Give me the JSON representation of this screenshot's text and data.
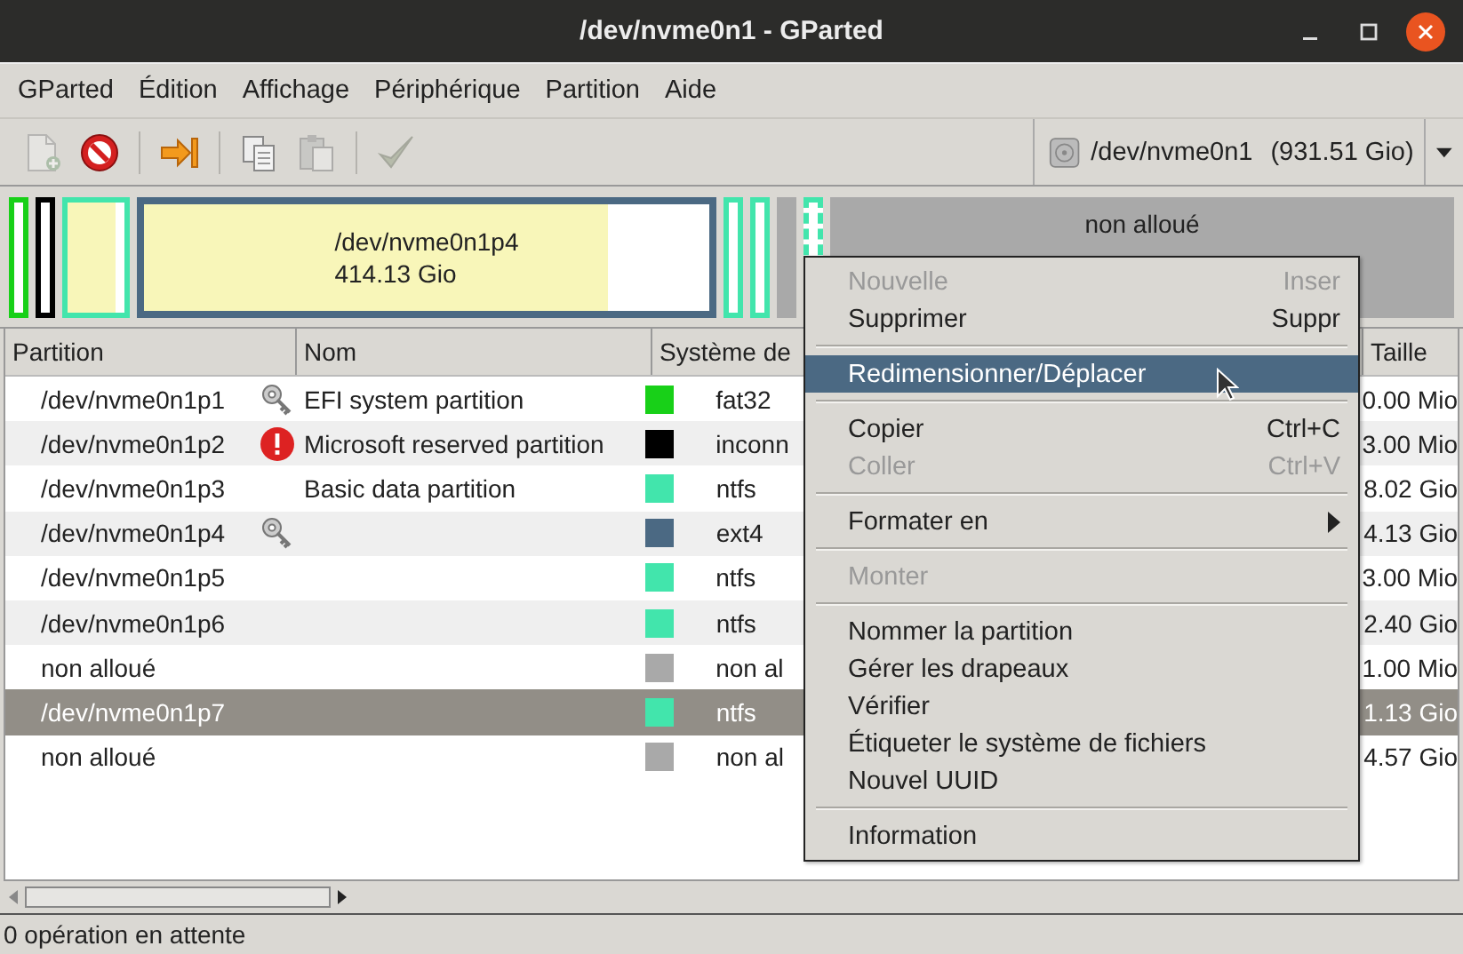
{
  "window": {
    "title": "/dev/nvme0n1 - GParted"
  },
  "menubar": [
    "GParted",
    "Édition",
    "Affichage",
    "Périphérique",
    "Partition",
    "Aide"
  ],
  "toolbar": [
    {
      "kind": "new",
      "disabled": true
    },
    {
      "kind": "delete",
      "disabled": false
    },
    {
      "kind": "sep"
    },
    {
      "kind": "resize",
      "disabled": false
    },
    {
      "kind": "sep"
    },
    {
      "kind": "copy",
      "disabled": false
    },
    {
      "kind": "paste",
      "disabled": true
    },
    {
      "kind": "sep"
    },
    {
      "kind": "apply",
      "disabled": true
    }
  ],
  "device": {
    "path": "/dev/nvme0n1",
    "size": "(931.51 Gio)"
  },
  "disk_map": [
    {
      "color": "#18d018",
      "selected": false
    },
    {
      "color": "#000000",
      "selected": false
    },
    {
      "color": "#42e5ac",
      "selected": false,
      "kind": "medium"
    },
    {
      "color": "#4b6983",
      "level": 0.82,
      "selected": false,
      "name": "/dev/nvme0n1p4",
      "size": "414.13 Gio",
      "kind": "wide"
    },
    {
      "color": "#42e5ac",
      "selected": false
    },
    {
      "color": "#42e5ac",
      "selected": false
    },
    {
      "color": "#a9a9a9",
      "kind": "unallocated",
      "selected": false
    },
    {
      "color": "#42e5ac",
      "selected": true
    },
    {
      "color": "#a9a9a9",
      "kind": "unallocated_wide",
      "selected": false,
      "name": "non alloué"
    }
  ],
  "table": {
    "columns": [
      "Partition",
      "Nom",
      "Système de ",
      "Taille"
    ],
    "rows": [
      {
        "partition": "/dev/nvme0n1p1",
        "kind": "key",
        "name": "EFI system partition",
        "color": "#18d018",
        "fs": "fat32",
        "size": "0.00 Mio",
        "selected": false
      },
      {
        "partition": "/dev/nvme0n1p2",
        "kind": "warning",
        "name": "Microsoft reserved partition",
        "color": "#000000",
        "fs": "inconn",
        "size": "3.00 Mio",
        "selected": false
      },
      {
        "partition": "/dev/nvme0n1p3",
        "kind": "plain",
        "name": "Basic data partition",
        "color": "#42e5ac",
        "fs": "ntfs",
        "size": "8.02 Gio",
        "selected": false
      },
      {
        "partition": "/dev/nvme0n1p4",
        "kind": "key",
        "name": "",
        "color": "#4b6983",
        "fs": "ext4",
        "size": "4.13 Gio",
        "selected": false
      },
      {
        "partition": "/dev/nvme0n1p5",
        "kind": "plain",
        "name": "",
        "color": "#42e5ac",
        "fs": "ntfs",
        "size": "3.00 Mio",
        "selected": false
      },
      {
        "partition": "/dev/nvme0n1p6",
        "kind": "plain",
        "name": "",
        "color": "#42e5ac",
        "fs": "ntfs",
        "size": "2.40 Gio",
        "selected": false
      },
      {
        "partition": "non alloué",
        "kind": "plain",
        "name": "",
        "color": "#a9a9a9",
        "fs": "non al",
        "size": "1.00 Mio",
        "selected": false
      },
      {
        "partition": "/dev/nvme0n1p7",
        "kind": "plain",
        "name": "",
        "color": "#42e5ac",
        "fs": "ntfs",
        "size": "1.13 Gio",
        "selected": true
      },
      {
        "partition": "non alloué",
        "kind": "plain",
        "name": "",
        "color": "#a9a9a9",
        "fs": "non al",
        "size": "4.57 Gio",
        "selected": false
      }
    ]
  },
  "context_menu": [
    {
      "kind": "item",
      "label": "Nouvelle",
      "shortcut": "Inser",
      "disabled": true,
      "selected": false
    },
    {
      "kind": "item",
      "label": "Supprimer",
      "shortcut": "Suppr",
      "disabled": false,
      "selected": false
    },
    {
      "kind": "separator"
    },
    {
      "kind": "item",
      "label": "Redimensionner/Déplacer",
      "disabled": false,
      "selected": true
    },
    {
      "kind": "separator"
    },
    {
      "kind": "item",
      "label": "Copier",
      "shortcut": "Ctrl+C",
      "disabled": false,
      "selected": false
    },
    {
      "kind": "item",
      "label": "Coller",
      "shortcut": "Ctrl+V",
      "disabled": true,
      "selected": false
    },
    {
      "kind": "separator"
    },
    {
      "kind": "submenu",
      "label": "Formater en",
      "disabled": false,
      "selected": false
    },
    {
      "kind": "separator"
    },
    {
      "kind": "item",
      "label": "Monter",
      "disabled": true,
      "selected": false
    },
    {
      "kind": "separator"
    },
    {
      "kind": "item",
      "label": "Nommer la partition",
      "disabled": false,
      "selected": false
    },
    {
      "kind": "item",
      "label": "Gérer les drapeaux",
      "disabled": false,
      "selected": false
    },
    {
      "kind": "item",
      "label": "Vérifier",
      "disabled": false,
      "selected": false
    },
    {
      "kind": "item",
      "label": "Étiqueter le système de fichiers",
      "disabled": false,
      "selected": false
    },
    {
      "kind": "item",
      "label": "Nouvel UUID",
      "disabled": false,
      "selected": false
    },
    {
      "kind": "separator"
    },
    {
      "kind": "item",
      "label": "Information",
      "disabled": false,
      "selected": false
    }
  ],
  "status_bar": "0 opération en attente"
}
